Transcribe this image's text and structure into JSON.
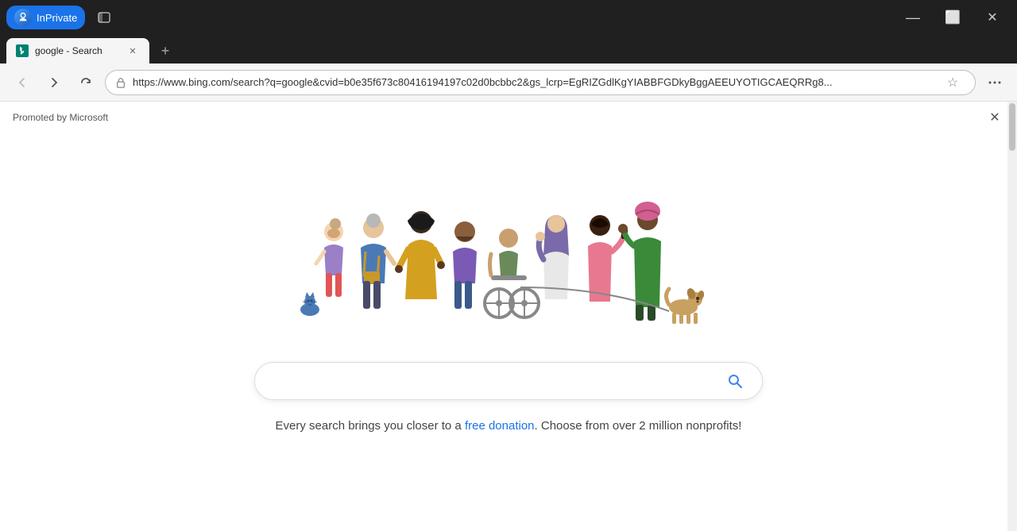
{
  "browser": {
    "title_bar": {
      "inprivate_label": "InPrivate"
    },
    "tab": {
      "title": "google - Search",
      "favicon_alt": "bing-favicon"
    },
    "address_bar": {
      "url": "https://www.bing.com/search?q=google&cvid=b0e35f673c80416194197c02d0bcbbc2&gs_lcrp=EgRIZGdlKgYIABBFGDkyBggAEEUYOTIGCAEQRRg8...",
      "new_tab_label": "+",
      "back_label": "‹",
      "forward_label": "›",
      "refresh_label": "↻",
      "more_label": "···",
      "favorites_label": "☆"
    }
  },
  "page": {
    "promo_text": "Promoted by Microsoft",
    "illustration_alt": "diverse-people-group",
    "search_placeholder": "",
    "tagline_before": "Every search brings you closer to a ",
    "tagline_link": "free donation",
    "tagline_after": ". Choose from over 2 million nonprofits!"
  },
  "colors": {
    "accent": "#4285f4",
    "link": "#1a73e8",
    "text": "#444444",
    "border": "#dddddd"
  }
}
